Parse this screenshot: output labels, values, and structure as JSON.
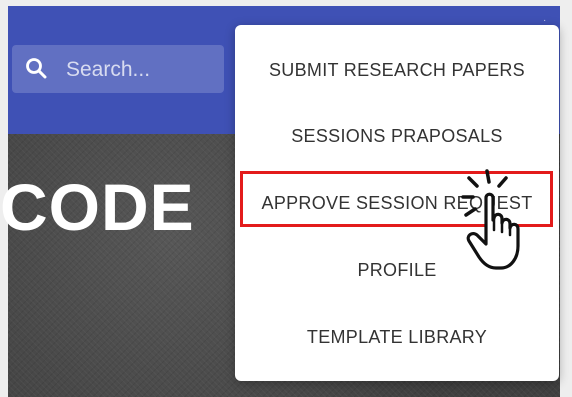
{
  "search": {
    "placeholder": "Search..."
  },
  "hero": {
    "title": "CODE"
  },
  "menu": {
    "items": [
      {
        "label": "SUBMIT RESEARCH PAPERS"
      },
      {
        "label": "SESSIONS PRAPOSALS"
      },
      {
        "label": "APPROVE SESSION REQUEST"
      },
      {
        "label": "PROFILE"
      },
      {
        "label": "TEMPLATE LIBRARY"
      }
    ],
    "highlighted_index": 2
  },
  "colors": {
    "app_bar": "#3f51b5",
    "highlight": "#e31b1b",
    "menu_background": "#ffffff",
    "menu_text": "#333333"
  },
  "icons": {
    "search": "search-icon",
    "pointer": "hand-pointer-icon"
  }
}
